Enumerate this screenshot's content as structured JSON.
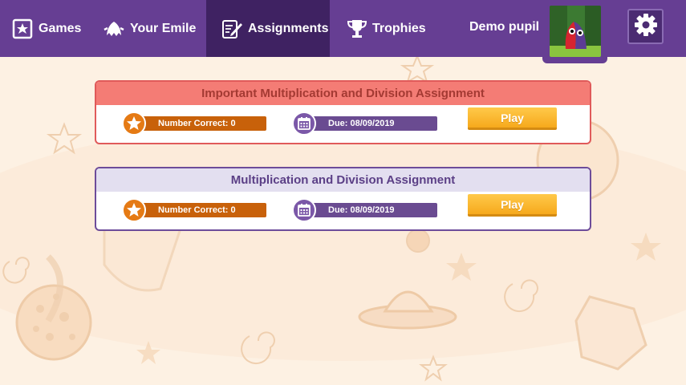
{
  "nav": {
    "items": [
      {
        "label": "Games",
        "icon": "book-star-icon"
      },
      {
        "label": "Your Emile",
        "icon": "ghost-icon"
      },
      {
        "label": "Assignments",
        "icon": "pencil-paper-icon",
        "active": true
      },
      {
        "label": "Trophies",
        "icon": "trophy-icon"
      }
    ],
    "user_name": "Demo pupil",
    "settings_icon": "gear-icon"
  },
  "assignments": [
    {
      "title": "Important Multiplication and Division Assignment",
      "important": true,
      "number_correct": "Number Correct: 0",
      "due": "Due: 08/09/2019",
      "play_label": "Play"
    },
    {
      "title": "Multiplication and Division Assignment",
      "important": false,
      "number_correct": "Number Correct: 0",
      "due": "Due: 08/09/2019",
      "play_label": "Play"
    }
  ],
  "colors": {
    "nav": "#663e93",
    "nav_active": "#3f2262",
    "important_header": "#f47c75",
    "normal_header": "#e3dff0",
    "correct_pill": "#c8610a",
    "due_pill": "#6a4b91",
    "play_button": "#f6a91c",
    "background": "#fdf1e3"
  }
}
